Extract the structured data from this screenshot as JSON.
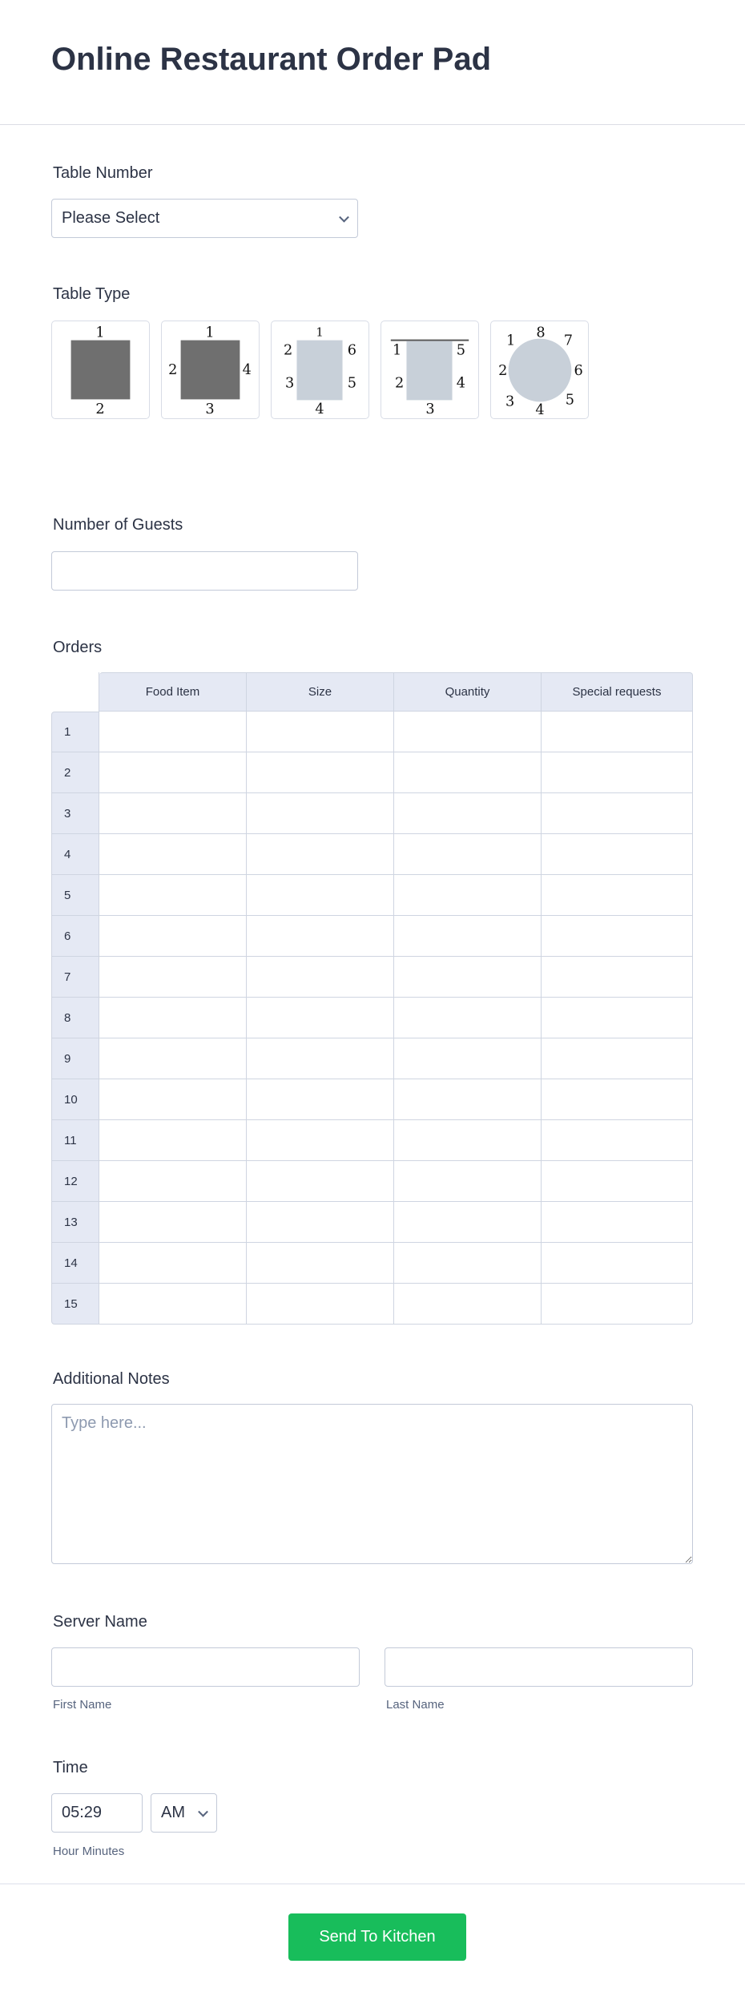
{
  "page": {
    "title": "Online Restaurant Order Pad"
  },
  "table_number": {
    "label": "Table Number",
    "selected": "Please Select"
  },
  "table_type": {
    "label": "Table Type",
    "options": [
      {
        "name": "two-seat-square",
        "shape": "square-dark",
        "seats": [
          "1",
          "2"
        ]
      },
      {
        "name": "four-seat-square",
        "shape": "square-dark",
        "seats": [
          "1",
          "2",
          "3",
          "4"
        ]
      },
      {
        "name": "six-seat-rectangle",
        "shape": "rect-light",
        "seats": [
          "1",
          "2",
          "3",
          "4",
          "5",
          "6"
        ]
      },
      {
        "name": "five-seat-booth",
        "shape": "booth-light",
        "seats": [
          "1",
          "2",
          "3",
          "4",
          "5"
        ]
      },
      {
        "name": "eight-seat-round",
        "shape": "round-light",
        "seats": [
          "1",
          "2",
          "3",
          "4",
          "5",
          "6",
          "7",
          "8"
        ]
      }
    ]
  },
  "guests": {
    "label": "Number of Guests",
    "value": ""
  },
  "orders": {
    "label": "Orders",
    "columns": [
      "Food Item",
      "Size",
      "Quantity",
      "Special requests"
    ],
    "rows": [
      "1",
      "2",
      "3",
      "4",
      "5",
      "6",
      "7",
      "8",
      "9",
      "10",
      "11",
      "12",
      "13",
      "14",
      "15"
    ]
  },
  "notes": {
    "label": "Additional Notes",
    "placeholder": "Type here...",
    "value": ""
  },
  "server_name": {
    "label": "Server Name",
    "first_value": "",
    "last_value": "",
    "first_sublabel": "First Name",
    "last_sublabel": "Last Name"
  },
  "time": {
    "label": "Time",
    "value": "05:29",
    "ampm": "AM",
    "sublabel": "Hour Minutes"
  },
  "submit": {
    "label": "Send To Kitchen",
    "color": "#18bd5b"
  }
}
